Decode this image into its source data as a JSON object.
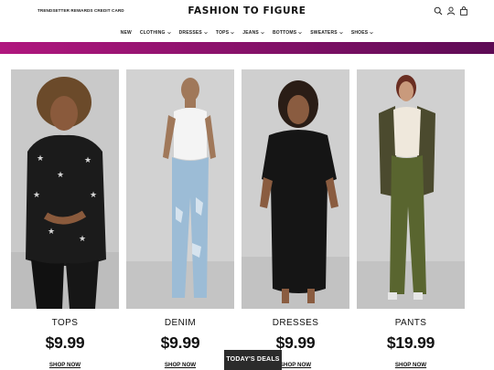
{
  "header": {
    "promo_link": "TRENDSETTER REWARDS CREDIT CARD",
    "logo": "FASHION TO FIGURE",
    "icons": [
      "search-icon",
      "account-icon",
      "bag-icon"
    ]
  },
  "nav": {
    "items": [
      {
        "label": "NEW",
        "dropdown": false
      },
      {
        "label": "CLOTHING",
        "dropdown": true
      },
      {
        "label": "DRESSES",
        "dropdown": true
      },
      {
        "label": "TOPS",
        "dropdown": true
      },
      {
        "label": "JEANS",
        "dropdown": true
      },
      {
        "label": "BOTTOMS",
        "dropdown": true
      },
      {
        "label": "SWEATERS",
        "dropdown": true
      },
      {
        "label": "SHOES",
        "dropdown": true
      }
    ]
  },
  "banner": {
    "color_start": "#b0177e",
    "color_end": "#5d0b55"
  },
  "categories": [
    {
      "title": "TOPS",
      "price": "$9.99",
      "cta": "SHOP NOW"
    },
    {
      "title": "DENIM",
      "price": "$9.99",
      "cta": "SHOP NOW"
    },
    {
      "title": "DRESSES",
      "price": "$9.99",
      "cta": "SHOP NOW"
    },
    {
      "title": "PANTS",
      "price": "$19.99",
      "cta": "SHOP NOW"
    }
  ],
  "floating": {
    "deals_label": "TODAY'S DEALS"
  }
}
